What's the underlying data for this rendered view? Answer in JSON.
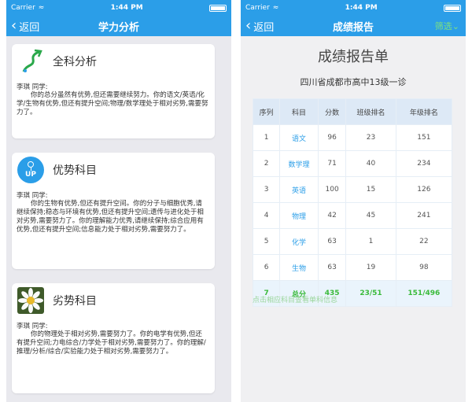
{
  "status_bar": {
    "carrier": "Carrier",
    "wifi_icon": "wifi-icon",
    "time": "1:44 PM"
  },
  "left": {
    "nav": {
      "back_label": "返回",
      "title": "学力分析"
    },
    "cards": [
      {
        "title": "全科分析",
        "icon": "arrow-trend-icon",
        "name": "李琪 同学:",
        "body": "你的总分虽然有优势,但还需要继续努力。你的语文/英语/化学/生物有优势,但还有提升空间;物理/数学理处于相对劣势,需要努力了。"
      },
      {
        "title": "优势科目",
        "icon": "up-icon",
        "icon_text": "UP",
        "name": "李琪 同学:",
        "body": "你的生物有优势,但还有提升空间。你的分子与细胞优秀,请继续保持;稳态与环境有优势,但还有提升空间;遗传与进化处于相对劣势,需要努力了。你的理解能力优秀,请继续保持;综合应用有优势,但还有提升空间;信息能力处于相对劣势,需要努力了。"
      },
      {
        "title": "劣势科目",
        "icon": "daisy-icon",
        "name": "李琪 同学:",
        "body": "你的物理处于相对劣势,需要努力了。你的电学有优势,但还有提升空间;力电综合/力学处于相对劣势,需要努力了。你的理解/推理/分析/综合/实验能力处于相对劣势,需要努力了。"
      }
    ]
  },
  "right": {
    "nav": {
      "back_label": "返回",
      "title": "成绩报告",
      "filter_label": "筛选"
    },
    "report_title": "成绩报告单",
    "exam_name": "四川省成都市高中13级一诊",
    "table": {
      "headers": [
        "序列",
        "科目",
        "分数",
        "班级排名",
        "年级排名"
      ],
      "rows": [
        [
          "1",
          "语文",
          "96",
          "23",
          "151"
        ],
        [
          "2",
          "数学理",
          "71",
          "40",
          "234"
        ],
        [
          "3",
          "英语",
          "100",
          "15",
          "126"
        ],
        [
          "4",
          "物理",
          "42",
          "45",
          "241"
        ],
        [
          "5",
          "化学",
          "63",
          "1",
          "22"
        ],
        [
          "6",
          "生物",
          "63",
          "19",
          "98"
        ]
      ],
      "total": [
        "7",
        "总分",
        "435",
        "23/51",
        "151/496"
      ]
    },
    "hint": "点击相应科目查看单科信息"
  }
}
